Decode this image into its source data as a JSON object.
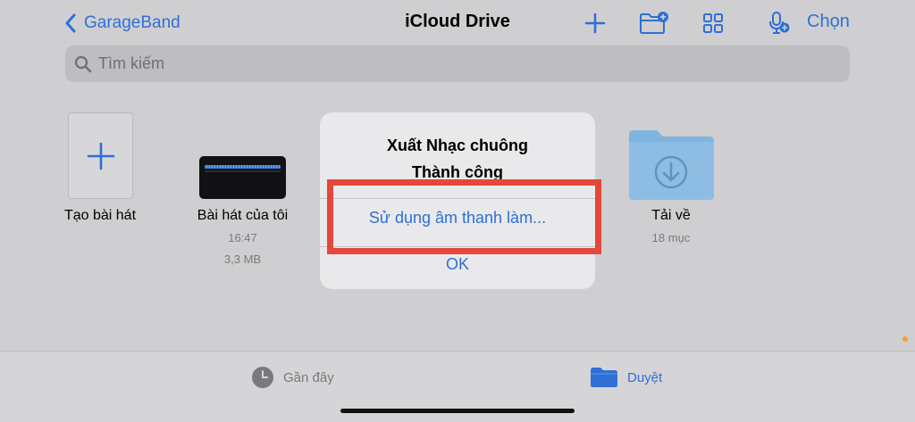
{
  "nav": {
    "back_label": "GarageBand",
    "title": "iCloud Drive",
    "select_label": "Chọn",
    "icons": [
      "add-icon",
      "new-folder-icon",
      "grid-view-icon",
      "voice-add-icon"
    ]
  },
  "search": {
    "placeholder": "Tìm kiếm"
  },
  "files": [
    {
      "name": "Tạo bài hát"
    },
    {
      "name": "Bài hát của tôi",
      "time": "16:47",
      "size": "3,3 MB"
    },
    {
      "name": "Tải về",
      "count": "18 mục"
    }
  ],
  "dialog": {
    "title_line1": "Xuất Nhạc chuông",
    "title_line2": "Thành công",
    "action": "Sử dụng âm thanh làm...",
    "ok": "OK"
  },
  "tabs": [
    {
      "label": "Gần đây",
      "active": false
    },
    {
      "label": "Duyệt",
      "active": true
    }
  ],
  "colors": {
    "accent": "#2f6fd6",
    "highlight": "#e4473b",
    "folder": "#7fb4de"
  }
}
